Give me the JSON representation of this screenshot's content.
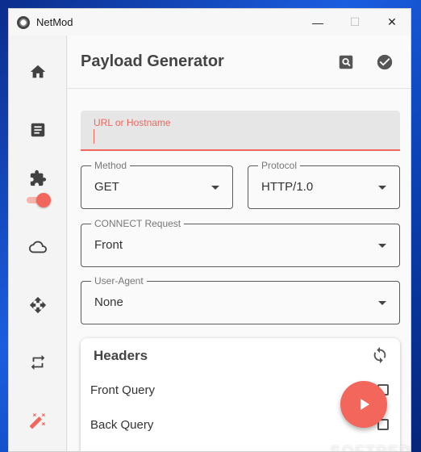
{
  "window": {
    "title": "NetMod",
    "minimize_glyph": "—",
    "maximize_glyph": "☐",
    "close_glyph": "✕"
  },
  "sidebar": {
    "items": [
      {
        "name": "home-icon"
      },
      {
        "name": "document-icon"
      },
      {
        "name": "puzzle-icon",
        "toggle_on": true
      },
      {
        "name": "cloud-icon"
      },
      {
        "name": "move-icon"
      },
      {
        "name": "repeat-icon"
      },
      {
        "name": "magic-wand-icon"
      }
    ]
  },
  "header": {
    "title": "Payload Generator",
    "icons": [
      "search-icon",
      "check-circle-icon"
    ]
  },
  "form": {
    "url_label": "URL or Hostname",
    "url_value": "",
    "method_label": "Method",
    "method_value": "GET",
    "protocol_label": "Protocol",
    "protocol_value": "HTTP/1.0",
    "connect_label": "CONNECT Request",
    "connect_value": "Front",
    "ua_label": "User-Agent",
    "ua_value": "None"
  },
  "headers_card": {
    "title": "Headers",
    "rows": [
      {
        "label": "Front Query",
        "checked": false
      },
      {
        "label": "Back Query",
        "checked": false
      }
    ]
  },
  "fab": {
    "icon": "play-icon"
  },
  "watermark": {
    "text": "SOFTPEDIA"
  },
  "colors": {
    "accent": "#f2665c",
    "text_dark": "#444444",
    "background": "#fafafa"
  }
}
